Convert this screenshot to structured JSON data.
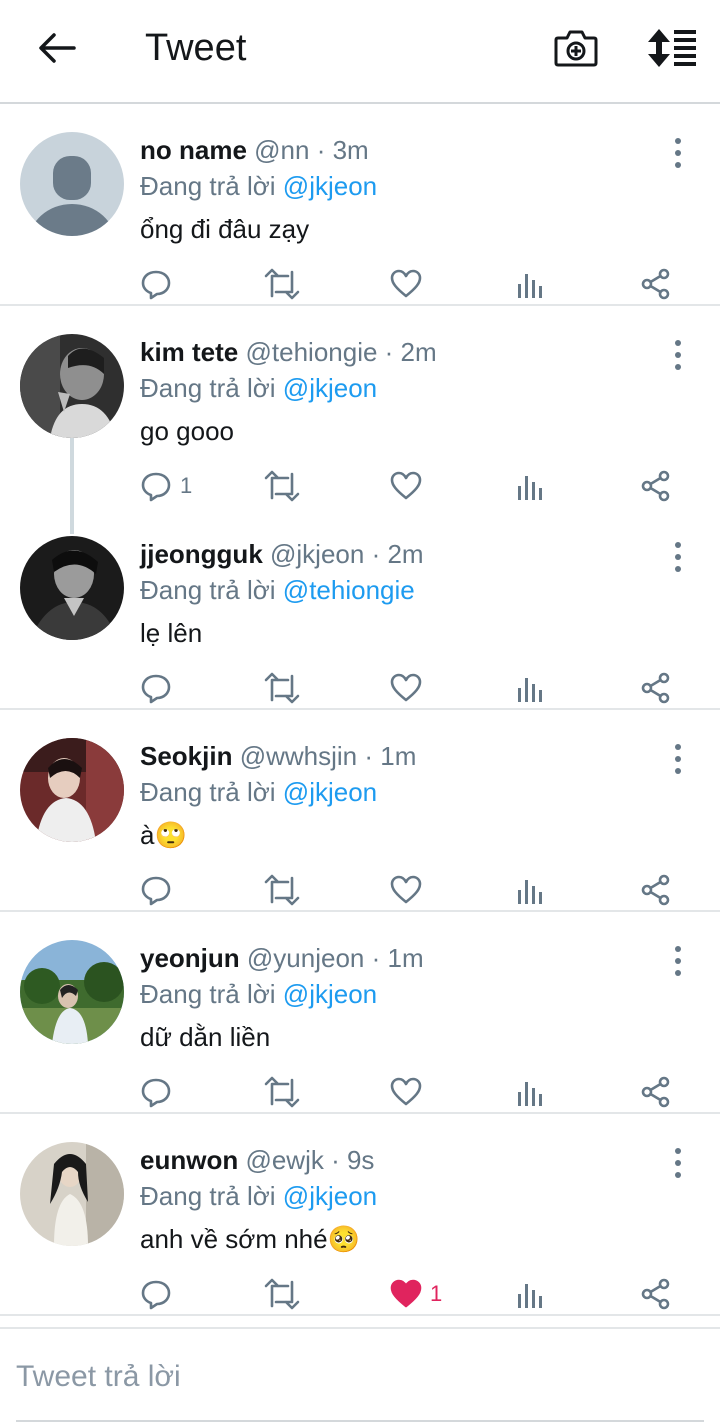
{
  "header": {
    "title": "Tweet",
    "back_icon": "arrow-left-icon",
    "camera_icon": "camera-plus-icon",
    "sort_icon": "sort-list-icon"
  },
  "colors": {
    "link": "#1d9bf0",
    "meta": "#657786",
    "like_active": "#e0245e",
    "divider": "#e3e6e8"
  },
  "tweets": [
    {
      "name": "no name",
      "handle": "@nn",
      "time": "· 3m",
      "reply_prefix": "Đang trả lời",
      "reply_to": "@jkjeon",
      "text": "ổng đi đâu zạy",
      "reply_count": "",
      "like_count": ""
    },
    {
      "name": "kim tete",
      "handle": "@tehiongie",
      "time": "· 2m",
      "reply_prefix": "Đang trả lời",
      "reply_to": "@jkjeon",
      "text": "go gooo",
      "reply_count": "1",
      "like_count": ""
    },
    {
      "name": "jjeongguk",
      "handle": "@jkjeon",
      "time": "· 2m",
      "reply_prefix": "Đang trả lời",
      "reply_to": "@tehiongie",
      "text": "lẹ lên",
      "reply_count": "",
      "like_count": ""
    },
    {
      "name": "Seokjin",
      "handle": "@wwhsjin",
      "time": "· 1m",
      "reply_prefix": "Đang trả lời",
      "reply_to": "@jkjeon",
      "text": "à🙄",
      "reply_count": "",
      "like_count": ""
    },
    {
      "name": "yeonjun",
      "handle": "@yunjeon",
      "time": "· 1m",
      "reply_prefix": "Đang trả lời",
      "reply_to": "@jkjeon",
      "text": "dữ dằn liền",
      "reply_count": "",
      "like_count": ""
    },
    {
      "name": "eunwon",
      "handle": "@ewjk",
      "time": "· 9s",
      "reply_prefix": "Đang trả lời",
      "reply_to": "@jkjeon",
      "text": "anh về sớm nhé🥺",
      "reply_count": "",
      "like_count": "1",
      "liked": true
    }
  ],
  "reply_bar": {
    "placeholder": "Tweet trả lời"
  }
}
